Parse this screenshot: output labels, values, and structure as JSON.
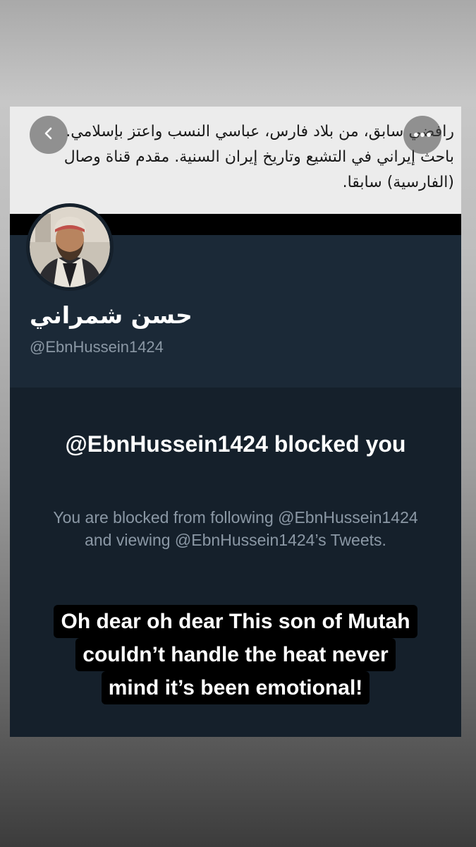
{
  "profile": {
    "bio": "رافضي سابق، من بلاد فارس، عباسي النسب واعتز بإسلامي. باحث إيراني في التشيع وتاريخ إيران السنية. مقدم قناة وصال (الفارسية) سابقا.",
    "display_name": "حسن شمراني",
    "handle": "@EbnHussein1424"
  },
  "blocked": {
    "title": "@EbnHussein1424 blocked you",
    "description": "You are blocked from following @EbnHussein1424 and viewing @EbnHussein1424’s Tweets."
  },
  "caption": {
    "lines": [
      "Oh dear oh dear This son of Mutah",
      "couldn’t handle the heat never",
      "mind it’s been emotional!"
    ]
  },
  "icons": {
    "back": "chevron-left-icon",
    "more": "more-dots-icon"
  },
  "colors": {
    "page_bg": "#15202b",
    "header_bg": "#1b2937",
    "muted_text": "#8b98a5"
  }
}
